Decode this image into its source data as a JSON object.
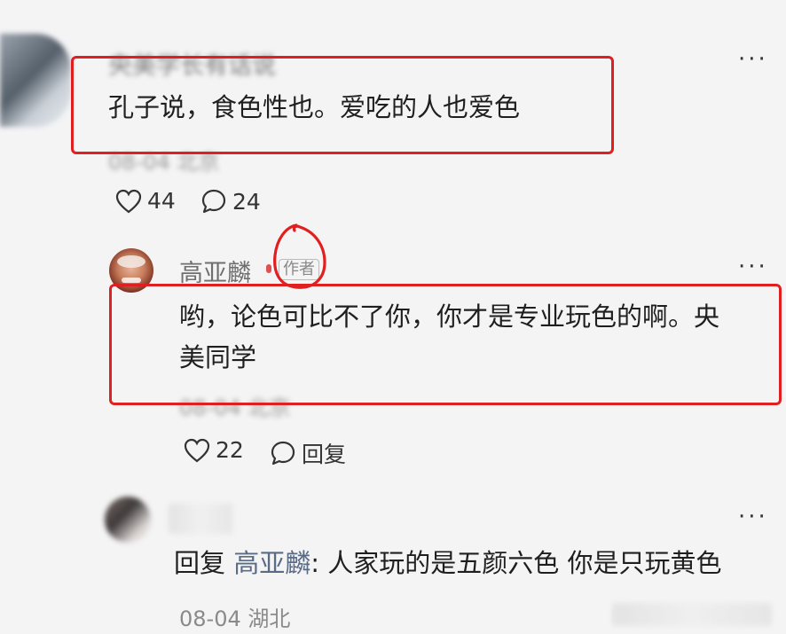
{
  "comments": [
    {
      "author": "央美学长有话说",
      "text": "孔子说，食色性也。爱吃的人也爱色",
      "date": "08-04",
      "location": "北京",
      "likes": "44",
      "replies": "24"
    },
    {
      "author": "高亚麟",
      "author_tag": "作者",
      "text_line1": "哟，论色可比不了你，你才是专业玩色的啊。央",
      "text_line2": "美同学",
      "date": "08-04",
      "location": "北京",
      "likes": "22",
      "reply_label": "回复"
    },
    {
      "reply_prefix": "回复",
      "reply_to": "高亚麟",
      "text": ": 人家玩的是五颜六色 你是只玩黄色",
      "date": "08-04",
      "location": "湖北"
    }
  ],
  "more_label": "···",
  "colors": {
    "annotation_red": "#e02020",
    "background": "#f4f4f5"
  }
}
